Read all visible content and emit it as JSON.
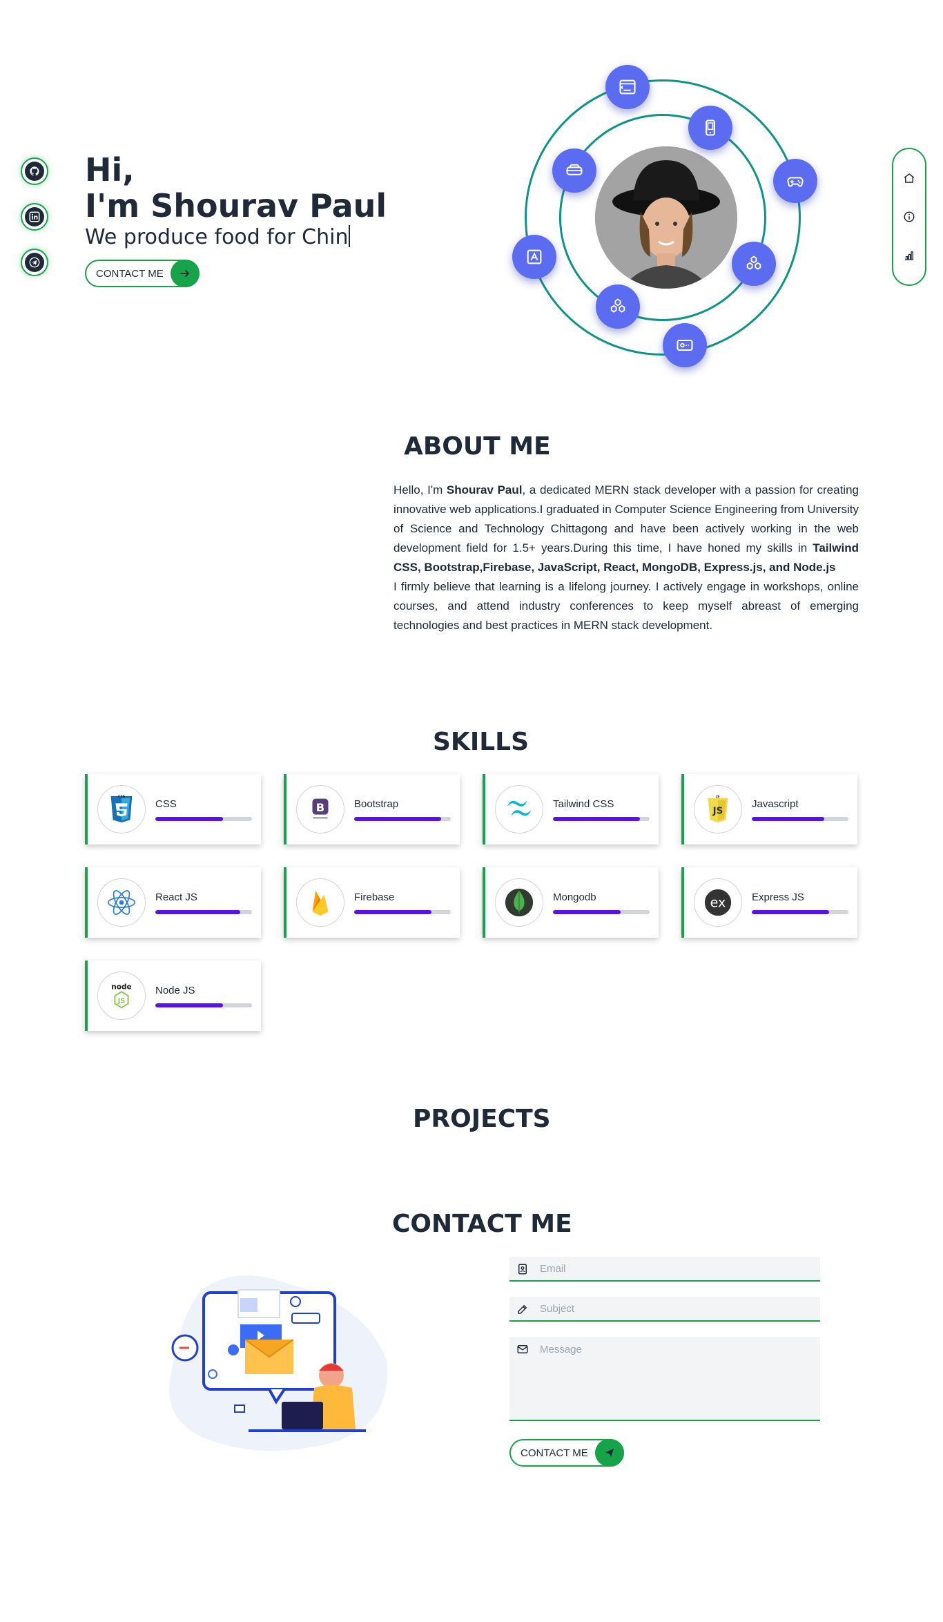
{
  "socials": [
    {
      "name": "github",
      "icon": "github-icon"
    },
    {
      "name": "linkedin",
      "icon": "linkedin-icon"
    },
    {
      "name": "telegram",
      "icon": "telegram-icon"
    }
  ],
  "hero": {
    "greeting": "Hi,",
    "name": "I'm Shourav Paul",
    "typing_text": "We produce food for Chin",
    "button_label": "CONTACT ME"
  },
  "sidenav": [
    {
      "icon": "home-icon"
    },
    {
      "icon": "info-icon"
    },
    {
      "icon": "chart-icon"
    }
  ],
  "about": {
    "title": "ABOUT ME",
    "p1_a": "Hello, I'm ",
    "p1_name": "Shourav Paul",
    "p1_b": ", a dedicated MERN stack developer with a passion for creating innovative web applications.I graduated in Computer Science Engineering from University of Science and Technology Chittagong and have been actively working in the web development field for 1.5+ years.During this time, I have honed my skills in ",
    "p1_skills": "Tailwind CSS, Bootstrap,Firebase, JavaScript, React, MongoDB, Express.js, and Node.js",
    "p2": "I firmly believe that learning is a lifelong journey. I actively engage in workshops, online courses, and attend industry conferences to keep myself abreast of emerging technologies and best practices in MERN stack development."
  },
  "skills": {
    "title": "SKILLS",
    "items": [
      {
        "label": "CSS",
        "level": 0.7,
        "icon": "css3-icon"
      },
      {
        "label": "Bootstrap",
        "level": 0.9,
        "icon": "bootstrap-icon"
      },
      {
        "label": "Tailwind CSS",
        "level": 0.9,
        "icon": "tailwind-icon"
      },
      {
        "label": "Javascript",
        "level": 0.75,
        "icon": "javascript-icon"
      },
      {
        "label": "React JS",
        "level": 0.88,
        "icon": "react-icon"
      },
      {
        "label": "Firebase",
        "level": 0.8,
        "icon": "firebase-icon"
      },
      {
        "label": "Mongodb",
        "level": 0.7,
        "icon": "mongodb-icon"
      },
      {
        "label": "Express JS",
        "level": 0.8,
        "icon": "express-icon"
      },
      {
        "label": "Node JS",
        "level": 0.7,
        "icon": "nodejs-icon"
      }
    ]
  },
  "projects": {
    "title": "PROJECTS"
  },
  "contact": {
    "title": "CONTACT ME",
    "email_placeholder": "Email",
    "subject_placeholder": "Subject",
    "message_placeholder": "Message",
    "button_label": "CONTACT ME"
  },
  "colors": {
    "accent": "#16a34a",
    "orbit": "#5b6cf0",
    "ring": "#0d9488",
    "bar": "#5b12e8",
    "text": "#1f2937"
  }
}
